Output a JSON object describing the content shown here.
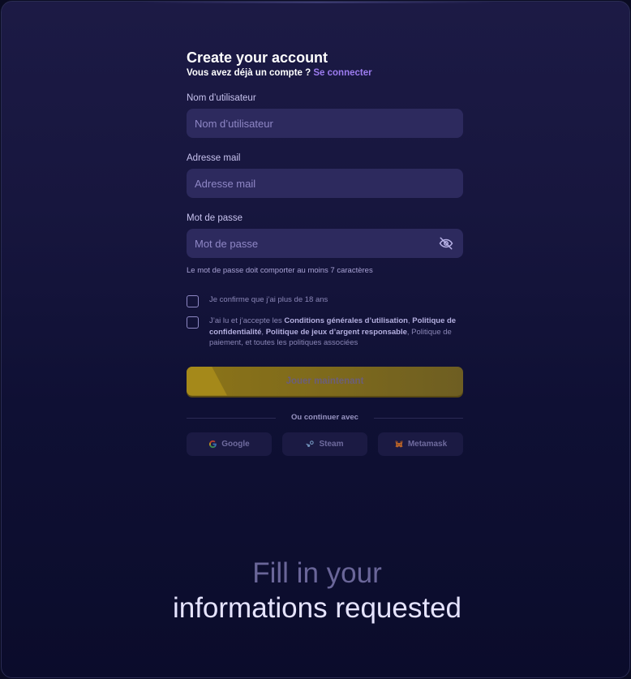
{
  "form": {
    "title": "Create your account",
    "subtitle_prefix": "Vous avez déjà un compte ? ",
    "subtitle_link": "Se connecter",
    "username": {
      "label": "Nom d’utilisateur",
      "placeholder": "Nom d’utilisateur"
    },
    "email": {
      "label": "Adresse mail",
      "placeholder": "Adresse mail"
    },
    "password": {
      "label": "Mot de passe",
      "placeholder": "Mot de passe",
      "hint": "Le mot de passe doit comporter au moins 7 caractères"
    },
    "checkbox_age": "Je confirme que j’ai plus de 18 ans",
    "checkbox_terms": {
      "prefix": "J’ai lu et j’accepte les ",
      "cgu": "Conditions générales d’utilisation",
      "sep1": ", ",
      "privacy": "Politique de confidentialité",
      "sep2": ", ",
      "gaming": "Politique de jeux d’argent responsable",
      "suffix": ", Politique de paiement, et toutes les politiques associées"
    },
    "cta": "Jouer maintenant",
    "divider": "Ou continuer avec",
    "socials": [
      "Google",
      "Steam",
      "Metamask"
    ]
  },
  "caption": {
    "line1": "Fill in your",
    "line2": "informations requested"
  },
  "colors": {
    "link": "#9d7cf0",
    "cta": "#8c7418",
    "input_bg": "#2d2a5e"
  },
  "icons": [
    "eye-off-icon",
    "google-icon",
    "steam-icon",
    "metamask-icon"
  ]
}
